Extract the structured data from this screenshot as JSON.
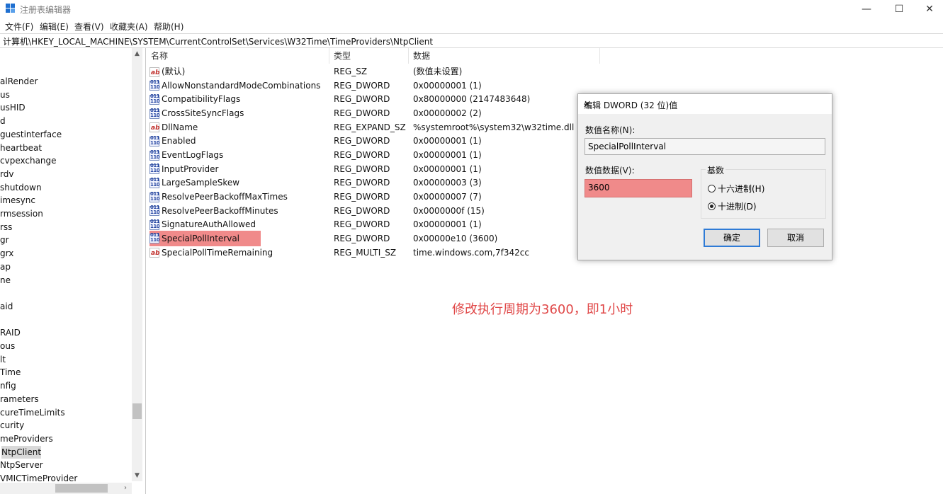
{
  "window": {
    "title": "注册表编辑器",
    "minimize": "—",
    "maximize": "☐",
    "close": "✕"
  },
  "menu": [
    "文件(F)",
    "编辑(E)",
    "查看(V)",
    "收藏夹(A)",
    "帮助(H)"
  ],
  "address": "计算机\\HKEY_LOCAL_MACHINE\\SYSTEM\\CurrentControlSet\\Services\\W32Time\\TimeProviders\\NtpClient",
  "tree": {
    "items": [
      "alRender",
      "us",
      "usHID",
      "d",
      "guestinterface",
      "heartbeat",
      "cvpexchange",
      "rdv",
      "shutdown",
      "imesync",
      "rmsession",
      "rss",
      "gr",
      "grx",
      "ap",
      "ne",
      "",
      "aid",
      "",
      "RAID",
      "ous",
      "lt",
      "Time",
      "nfig",
      "rameters",
      "cureTimeLimits",
      "curity",
      "meProviders",
      "NtpClient",
      "NtpServer",
      "VMICTimeProvider"
    ],
    "selected_index": 28
  },
  "list": {
    "columns": [
      "名称",
      "类型",
      "数据"
    ],
    "rows": [
      {
        "icon": "string-value-icon",
        "name": "(默认)",
        "type": "REG_SZ",
        "data": "(数值未设置)"
      },
      {
        "icon": "binary-value-icon",
        "name": "AllowNonstandardModeCombinations",
        "type": "REG_DWORD",
        "data": "0x00000001 (1)"
      },
      {
        "icon": "binary-value-icon",
        "name": "CompatibilityFlags",
        "type": "REG_DWORD",
        "data": "0x80000000 (2147483648)"
      },
      {
        "icon": "binary-value-icon",
        "name": "CrossSiteSyncFlags",
        "type": "REG_DWORD",
        "data": "0x00000002 (2)"
      },
      {
        "icon": "string-value-icon",
        "name": "DllName",
        "type": "REG_EXPAND_SZ",
        "data": "%systemroot%\\system32\\w32time.dll"
      },
      {
        "icon": "binary-value-icon",
        "name": "Enabled",
        "type": "REG_DWORD",
        "data": "0x00000001 (1)"
      },
      {
        "icon": "binary-value-icon",
        "name": "EventLogFlags",
        "type": "REG_DWORD",
        "data": "0x00000001 (1)"
      },
      {
        "icon": "binary-value-icon",
        "name": "InputProvider",
        "type": "REG_DWORD",
        "data": "0x00000001 (1)"
      },
      {
        "icon": "binary-value-icon",
        "name": "LargeSampleSkew",
        "type": "REG_DWORD",
        "data": "0x00000003 (3)"
      },
      {
        "icon": "binary-value-icon",
        "name": "ResolvePeerBackoffMaxTimes",
        "type": "REG_DWORD",
        "data": "0x00000007 (7)"
      },
      {
        "icon": "binary-value-icon",
        "name": "ResolvePeerBackoffMinutes",
        "type": "REG_DWORD",
        "data": "0x0000000f (15)"
      },
      {
        "icon": "binary-value-icon",
        "name": "SignatureAuthAllowed",
        "type": "REG_DWORD",
        "data": "0x00000001 (1)"
      },
      {
        "icon": "binary-value-icon",
        "name": "SpecialPollInterval",
        "type": "REG_DWORD",
        "data": "0x00000e10 (3600)",
        "selected": true
      },
      {
        "icon": "string-value-icon",
        "name": "SpecialPollTimeRemaining",
        "type": "REG_MULTI_SZ",
        "data": "time.windows.com,7f342cc"
      }
    ]
  },
  "annotation": "修改执行周期为3600，即1小时",
  "dialog": {
    "title": "编辑 DWORD (32 位)值",
    "name_label": "数值名称(N):",
    "name_value": "SpecialPollInterval",
    "data_label": "数值数据(V):",
    "data_value": "3600",
    "base_label": "基数",
    "hex_option": "十六进制(H)",
    "dec_option": "十进制(D)",
    "selected_base": "dec",
    "ok": "确定",
    "cancel": "取消"
  },
  "colors": {
    "highlight": "#f08a8a",
    "annotation": "#e04848",
    "accent": "#2f7bd6"
  }
}
